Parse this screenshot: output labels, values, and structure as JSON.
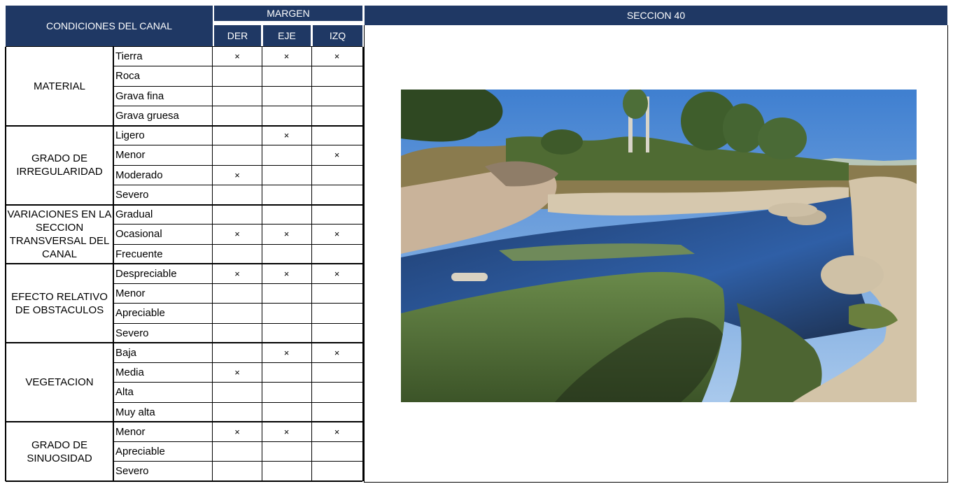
{
  "header": {
    "condiciones": "CONDICIONES DEL CANAL",
    "margen": "MARGEN",
    "der": "DER",
    "eje": "EJE",
    "izq": "IZQ",
    "seccion": "SECCION 40"
  },
  "mark_symbol": "×",
  "groups": [
    {
      "name": "MATERIAL",
      "rows": [
        {
          "label": "Tierra",
          "der": "×",
          "eje": "×",
          "izq": "×"
        },
        {
          "label": "Roca",
          "der": "",
          "eje": "",
          "izq": ""
        },
        {
          "label": "Grava fina",
          "der": "",
          "eje": "",
          "izq": ""
        },
        {
          "label": "Grava gruesa",
          "der": "",
          "eje": "",
          "izq": ""
        }
      ]
    },
    {
      "name": "GRADO DE IRREGULARIDAD",
      "rows": [
        {
          "label": "Ligero",
          "der": "",
          "eje": "×",
          "izq": ""
        },
        {
          "label": "Menor",
          "der": "",
          "eje": "",
          "izq": "×"
        },
        {
          "label": "Moderado",
          "der": "×",
          "eje": "",
          "izq": ""
        },
        {
          "label": "Severo",
          "der": "",
          "eje": "",
          "izq": ""
        }
      ]
    },
    {
      "name": "VARIACIONES EN LA SECCION TRANSVERSAL DEL CANAL",
      "rows": [
        {
          "label": "Gradual",
          "der": "",
          "eje": "",
          "izq": ""
        },
        {
          "label": "Ocasional",
          "der": "×",
          "eje": "×",
          "izq": "×"
        },
        {
          "label": "Frecuente",
          "der": "",
          "eje": "",
          "izq": ""
        }
      ]
    },
    {
      "name": "EFECTO RELATIVO DE OBSTACULOS",
      "rows": [
        {
          "label": "Despreciable",
          "der": "×",
          "eje": "×",
          "izq": "×"
        },
        {
          "label": "Menor",
          "der": "",
          "eje": "",
          "izq": ""
        },
        {
          "label": "Apreciable",
          "der": "",
          "eje": "",
          "izq": ""
        },
        {
          "label": "Severo",
          "der": "",
          "eje": "",
          "izq": ""
        }
      ]
    },
    {
      "name": "VEGETACION",
      "rows": [
        {
          "label": "Baja",
          "der": "",
          "eje": "×",
          "izq": "×"
        },
        {
          "label": "Media",
          "der": "×",
          "eje": "",
          "izq": ""
        },
        {
          "label": "Alta",
          "der": "",
          "eje": "",
          "izq": ""
        },
        {
          "label": "Muy alta",
          "der": "",
          "eje": "",
          "izq": ""
        }
      ]
    },
    {
      "name": "GRADO DE SINUOSIDAD",
      "rows": [
        {
          "label": "Menor",
          "der": "×",
          "eje": "×",
          "izq": "×"
        },
        {
          "label": "Apreciable",
          "der": "",
          "eje": "",
          "izq": ""
        },
        {
          "label": "Severo",
          "der": "",
          "eje": "",
          "izq": ""
        }
      ]
    }
  ],
  "colors": {
    "header_bg": "#1f3864",
    "header_text": "#ffffff"
  }
}
